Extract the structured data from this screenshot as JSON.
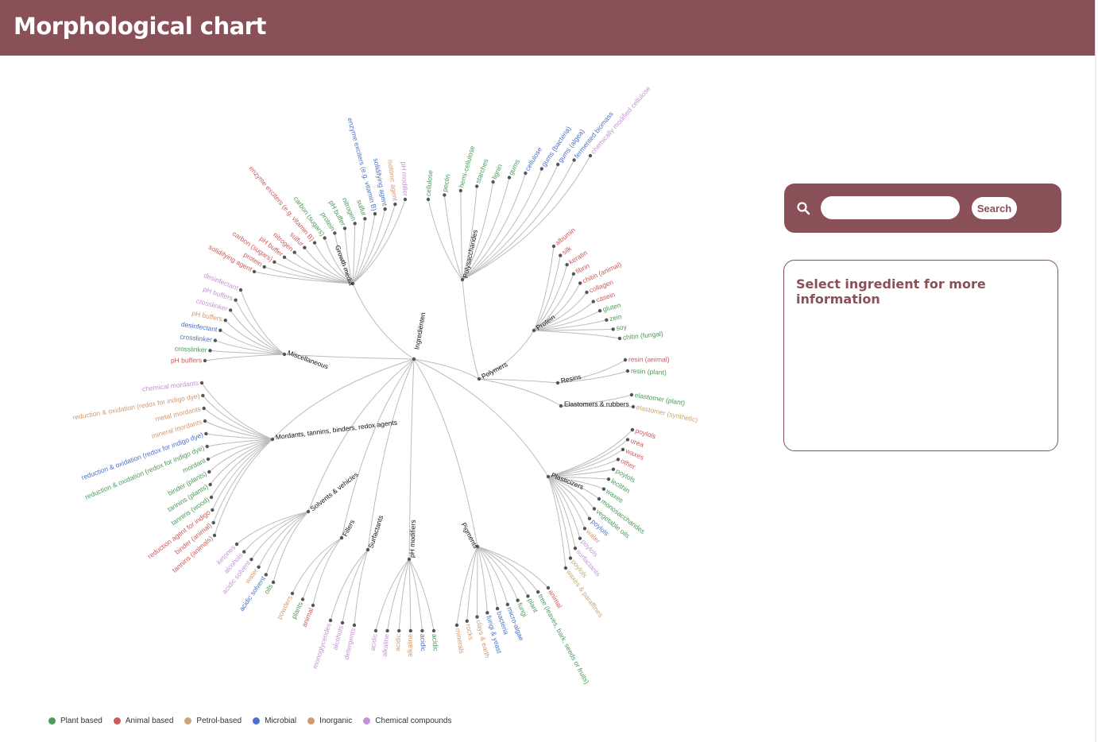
{
  "header": {
    "title": "Morphological chart"
  },
  "search": {
    "placeholder": "",
    "value": "",
    "button_label": "Search"
  },
  "info": {
    "title": "Select ingredient for more information"
  },
  "colors": {
    "brand": "#8a5057",
    "plant": "#4e9a59",
    "animal": "#cc5a5a",
    "petrol": "#c9a679",
    "microbial": "#4a72c8",
    "inorganic": "#d39a70",
    "chemical": "#c593d4"
  },
  "legend": [
    {
      "label": "Plant based",
      "color": "#4e9a59"
    },
    {
      "label": "Animal based",
      "color": "#cc5a5a"
    },
    {
      "label": "Petrol-based",
      "color": "#c9a679"
    },
    {
      "label": "Microbial",
      "color": "#4a72c8"
    },
    {
      "label": "Inorganic",
      "color": "#d39a70"
    },
    {
      "label": "Chemical compounds",
      "color": "#c593d4"
    }
  ],
  "tree": {
    "root": "Ingrediënten",
    "branches": [
      {
        "name": "Polymers",
        "children": [
          {
            "name": "Polysaccharides",
            "leaves": [
              [
                "cellulose",
                "plant"
              ],
              [
                "pectin",
                "plant"
              ],
              [
                "hemi-cellulose",
                "plant"
              ],
              [
                "starches",
                "plant"
              ],
              [
                "lignin",
                "plant"
              ],
              [
                "gums",
                "plant"
              ],
              [
                "cellulose",
                "microbial"
              ],
              [
                "gums (bacteria)",
                "microbial"
              ],
              [
                "gums (algea)",
                "microbial"
              ],
              [
                "fermented biomass",
                "microbial"
              ],
              [
                "chemically modified cellulose",
                "chemical"
              ]
            ]
          },
          {
            "name": "Protein",
            "leaves": [
              [
                "albumin",
                "animal"
              ],
              [
                "silk",
                "animal"
              ],
              [
                "keratin",
                "animal"
              ],
              [
                "fibrin",
                "animal"
              ],
              [
                "chitin (animal)",
                "animal"
              ],
              [
                "collagen",
                "animal"
              ],
              [
                "casein",
                "animal"
              ],
              [
                "gluten",
                "plant"
              ],
              [
                "zein",
                "plant"
              ],
              [
                "soy",
                "plant"
              ],
              [
                "chitin (fungal)",
                "plant"
              ]
            ]
          },
          {
            "name": "Resins",
            "leaves": [
              [
                "resin (animal)",
                "animal"
              ],
              [
                "resin (plant)",
                "plant"
              ]
            ]
          },
          {
            "name": "Elastomers & rubbers",
            "leaves": [
              [
                "elastomer (plant)",
                "plant"
              ],
              [
                "elastomer (synthetic)",
                "petrol"
              ]
            ]
          }
        ]
      },
      {
        "name": "Plasticizers",
        "leaves": [
          [
            "poylols",
            "animal"
          ],
          [
            "urea",
            "animal"
          ],
          [
            "waxes",
            "animal"
          ],
          [
            "other",
            "animal"
          ],
          [
            "poylols",
            "plant"
          ],
          [
            "lecithin",
            "plant"
          ],
          [
            "waxes",
            "plant"
          ],
          [
            "monosaccharides",
            "plant"
          ],
          [
            "vegetable oils",
            "plant"
          ],
          [
            "poylols",
            "microbial"
          ],
          [
            "water",
            "inorganic"
          ],
          [
            "poylols",
            "chemical"
          ],
          [
            "surfactants",
            "chemical"
          ],
          [
            "poylols",
            "petrol"
          ],
          [
            "waxes & paraffines",
            "petrol"
          ]
        ]
      },
      {
        "name": "Pigments",
        "leaves": [
          [
            "animal",
            "animal"
          ],
          [
            "tree (leaves, bark, seeds or fruits)",
            "plant"
          ],
          [
            "plant",
            "plant"
          ],
          [
            "fungi",
            "plant"
          ],
          [
            "micro-algae",
            "microbial"
          ],
          [
            "bacteria",
            "microbial"
          ],
          [
            "fungi & yeast",
            "microbial"
          ],
          [
            "clays & earth",
            "inorganic"
          ],
          [
            "rocks",
            "inorganic"
          ],
          [
            "minerals",
            "inorganic"
          ]
        ]
      },
      {
        "name": "pH modifiers",
        "leaves": [
          [
            "acidic",
            "plant"
          ],
          [
            "acidic",
            "microbial"
          ],
          [
            "alkaline",
            "inorganic"
          ],
          [
            "acidic",
            "inorganic"
          ],
          [
            "alkaline",
            "chemical"
          ],
          [
            "acidic",
            "chemical"
          ]
        ]
      },
      {
        "name": "Surfactants",
        "leaves": [
          [
            "detergents",
            "chemical"
          ],
          [
            "alcohols",
            "chemical"
          ],
          [
            "monoglycerides",
            "chemical"
          ]
        ]
      },
      {
        "name": "Fillers",
        "leaves": [
          [
            "animal",
            "animal"
          ],
          [
            "plants",
            "plant"
          ],
          [
            "powders",
            "inorganic"
          ]
        ]
      },
      {
        "name": "Solvents & vehicles",
        "leaves": [
          [
            "oils",
            "plant"
          ],
          [
            "acidic solvent",
            "microbial"
          ],
          [
            "water",
            "inorganic"
          ],
          [
            "acidic solvent",
            "chemical"
          ],
          [
            "alcohols",
            "chemical"
          ],
          [
            "ketones",
            "chemical"
          ]
        ]
      },
      {
        "name": "Mordants, tannins, binders, redox agents",
        "leaves": [
          [
            "tannins (animals)",
            "animal"
          ],
          [
            "binder (animal)",
            "animal"
          ],
          [
            "reduction agent for indigo",
            "animal"
          ],
          [
            "tannins (wood)",
            "plant"
          ],
          [
            "tannins (plants)",
            "plant"
          ],
          [
            "binder (plants)",
            "plant"
          ],
          [
            "mordant",
            "plant"
          ],
          [
            "reduction & oxidation (redox for indigo dye)",
            "plant"
          ],
          [
            "reduction & oxidation (redox for indigo dye)",
            "microbial"
          ],
          [
            "mineral mordants",
            "inorganic"
          ],
          [
            "metal mordants",
            "inorganic"
          ],
          [
            "reduction & oxidation (redox for indigo dye)",
            "inorganic"
          ],
          [
            "chemical mordants",
            "chemical"
          ]
        ]
      },
      {
        "name": "Miscellaneous",
        "leaves": [
          [
            "pH buffers",
            "animal"
          ],
          [
            "crosslinker",
            "plant"
          ],
          [
            "crosslinker",
            "microbial"
          ],
          [
            "desinfectant",
            "microbial"
          ],
          [
            "pH buffers",
            "inorganic"
          ],
          [
            "crosslinker",
            "chemical"
          ],
          [
            "pH buffers",
            "chemical"
          ],
          [
            "desinfectant",
            "chemical"
          ]
        ]
      },
      {
        "name": "Growth media",
        "leaves": [
          [
            "solidifying agent",
            "animal"
          ],
          [
            "protein",
            "animal"
          ],
          [
            "carbon (sugars)",
            "animal"
          ],
          [
            "pH buffer",
            "animal"
          ],
          [
            "nitrogen",
            "animal"
          ],
          [
            "sulfur",
            "animal"
          ],
          [
            "enzyme exciters (e.g. vitamin B)",
            "animal"
          ],
          [
            "carbon (sugars)",
            "plant"
          ],
          [
            "protein",
            "plant"
          ],
          [
            "pH buffer",
            "plant"
          ],
          [
            "nitrogen",
            "plant"
          ],
          [
            "sulfur",
            "plant"
          ],
          [
            "enzyme exciters (e.g. vitamin B)",
            "microbial"
          ],
          [
            "solidifying agent",
            "microbial"
          ],
          [
            "isotonic agent",
            "inorganic"
          ],
          [
            "pH modifier",
            "chemical"
          ]
        ]
      }
    ]
  }
}
